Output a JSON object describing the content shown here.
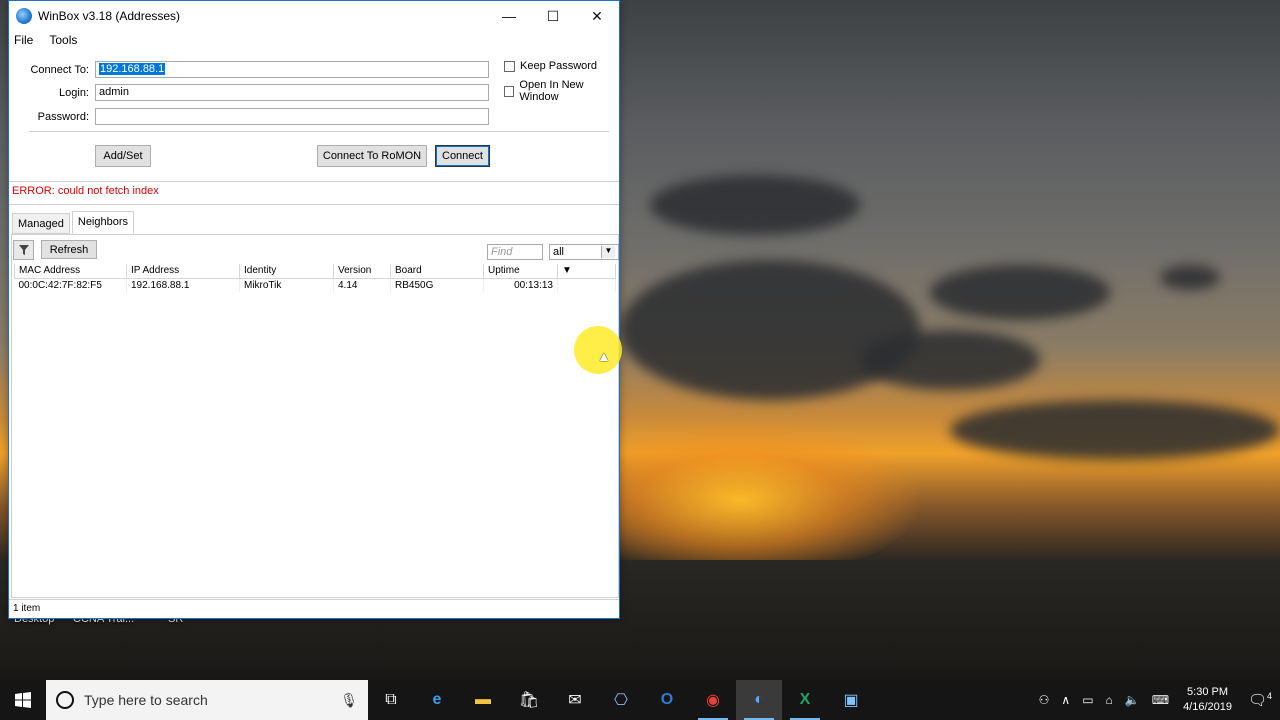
{
  "window": {
    "title": "WinBox v3.18 (Addresses)",
    "controls": {
      "minimize": "—",
      "maximize": "☐",
      "close": "✕"
    }
  },
  "menu": [
    "File",
    "Tools"
  ],
  "form": {
    "connect_to_label": "Connect To:",
    "connect_to_value": "192.168.88.1",
    "login_label": "Login:",
    "login_value": "admin",
    "password_label": "Password:",
    "password_value": "",
    "keep_password": "Keep Password",
    "open_new_window": "Open In New Window",
    "add_set": "Add/Set",
    "connect_romon": "Connect To RoMON",
    "connect": "Connect"
  },
  "error": "ERROR: could not fetch index",
  "tabs": [
    "Managed",
    "Neighbors"
  ],
  "active_tab": "Neighbors",
  "toolbar": {
    "refresh": "Refresh",
    "find_placeholder": "Find",
    "filter_value": "all"
  },
  "table": {
    "columns": [
      "MAC Address",
      "IP Address",
      "Identity",
      "Version",
      "Board",
      "Uptime"
    ],
    "rows": [
      [
        "00:0C:42:7F:82:F5",
        "192.168.88.1",
        "MikroTik",
        "4.14",
        "RB450G",
        "00:13:13"
      ]
    ]
  },
  "status": "1 item",
  "desktop_labels": [
    "Desktop",
    "CCNA Trai...",
    "SR"
  ],
  "taskbar": {
    "search_placeholder": "Type here to search",
    "time": "5:30 PM",
    "date": "4/16/2019",
    "notification_count": "4"
  }
}
